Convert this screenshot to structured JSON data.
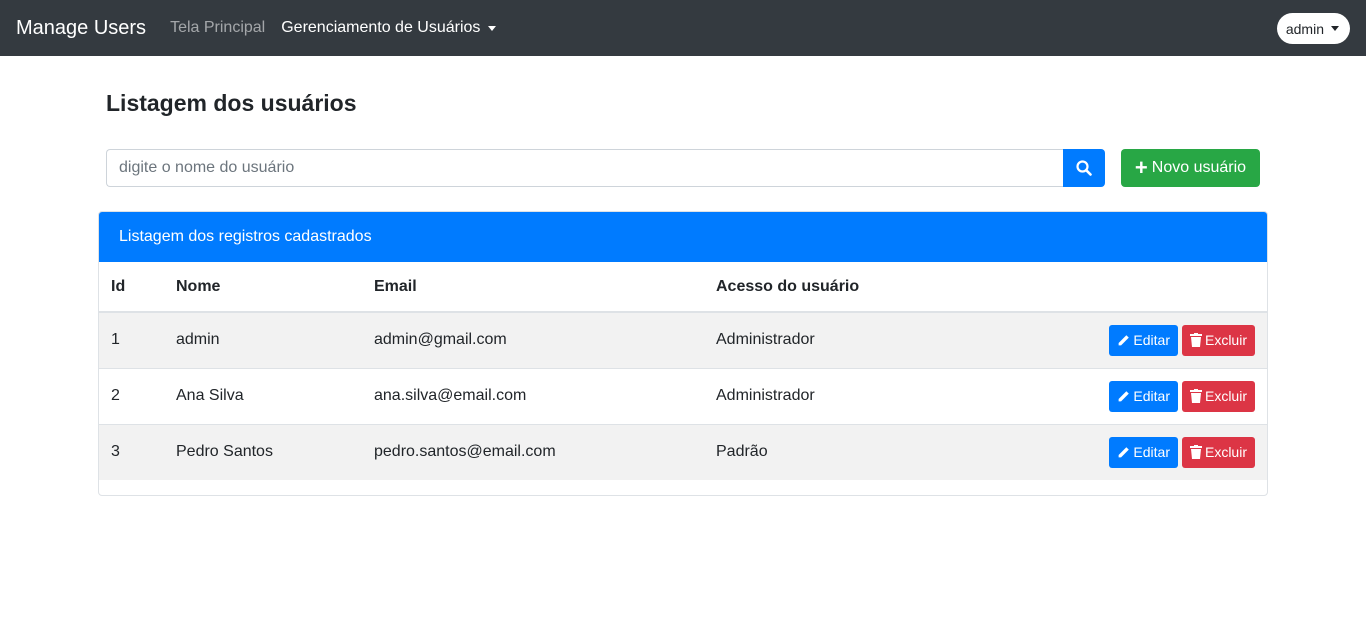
{
  "navbar": {
    "brand": "Manage Users",
    "links": [
      "Tela Principal",
      "Gerenciamento de Usuários"
    ],
    "user": "admin"
  },
  "page": {
    "title": "Listagem dos usuários"
  },
  "search": {
    "placeholder": "digite o nome do usuário",
    "value": ""
  },
  "new_button": "Novo usuário",
  "card": {
    "header": "Listagem dos registros cadastrados",
    "columns": [
      "Id",
      "Nome",
      "Email",
      "Acesso do usuário"
    ],
    "rows": [
      {
        "id": "1",
        "nome": "admin",
        "email": "admin@gmail.com",
        "acesso": "Administrador"
      },
      {
        "id": "2",
        "nome": "Ana Silva",
        "email": "ana.silva@email.com",
        "acesso": "Administrador"
      },
      {
        "id": "3",
        "nome": "Pedro Santos",
        "email": "pedro.santos@email.com",
        "acesso": "Padrão"
      }
    ],
    "edit_label": "Editar",
    "delete_label": "Excluir"
  },
  "icons": {
    "search": "search-icon",
    "plus": "plus-icon",
    "edit": "pencil-icon",
    "delete": "trash-icon",
    "dropdown": "caret-down-icon"
  },
  "colors": {
    "navbar": "#343a40",
    "primary": "#007bff",
    "success": "#28a745",
    "danger": "#dc3545"
  }
}
